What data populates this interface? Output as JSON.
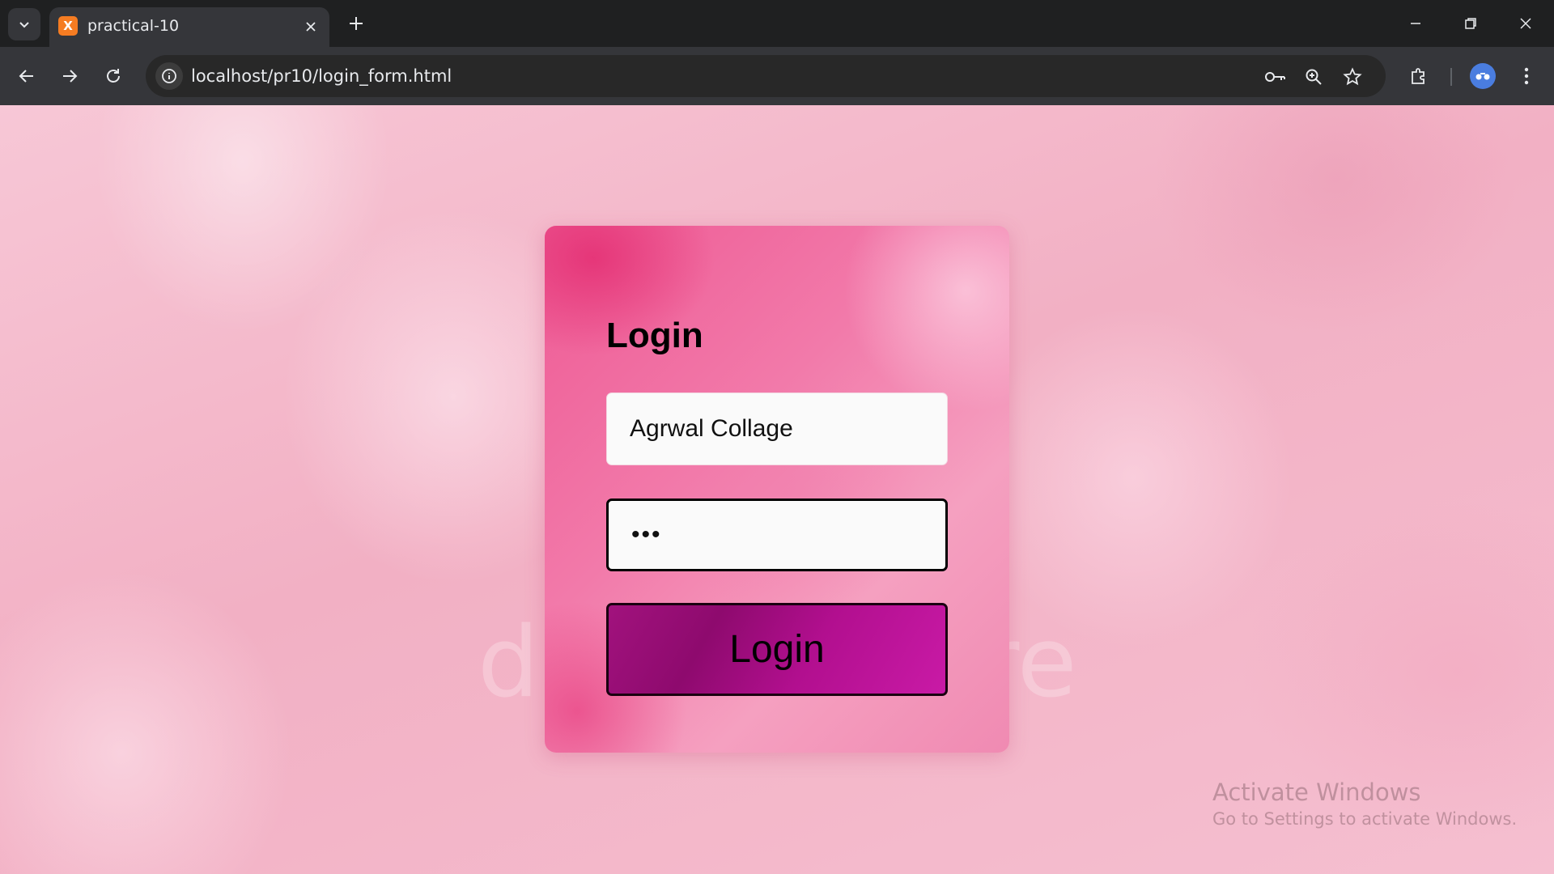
{
  "browser": {
    "tab_title": "practical-10",
    "url": "localhost/pr10/login_form.html",
    "favicon": "xampp-icon",
    "accent": "#f57c22"
  },
  "page": {
    "heading": "Login",
    "username_value": "Agrwal Collage",
    "password_display": "•••",
    "login_button_label": "Login",
    "colors": {
      "background": "#f4b6c8",
      "card": "#ee5a94",
      "button": "#a1127d"
    }
  },
  "overlay": {
    "activate_title": "Activate Windows",
    "activate_sub": "Go to Settings to activate Windows."
  }
}
